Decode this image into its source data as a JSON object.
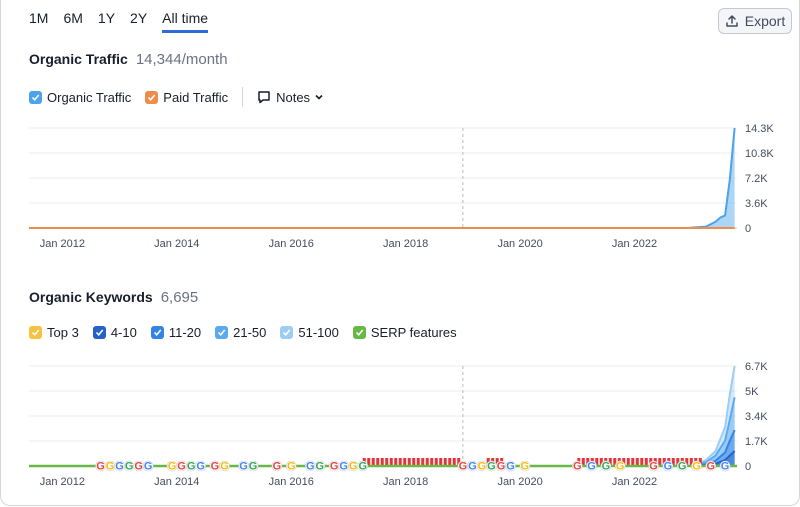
{
  "time_ranges": [
    "1M",
    "6M",
    "1Y",
    "2Y",
    "All time"
  ],
  "active_range": "All time",
  "export": {
    "label": "Export",
    "icon": "upload-icon"
  },
  "traffic": {
    "title": "Organic Traffic",
    "value": "14,344/month",
    "legend": [
      {
        "label": "Organic Traffic",
        "color": "#4aa3ec",
        "checked": true
      },
      {
        "label": "Paid Traffic",
        "color": "#ee8d4a",
        "checked": true
      }
    ],
    "notes_label": "Notes"
  },
  "keywords": {
    "title": "Organic Keywords",
    "value": "6,695",
    "legend": [
      {
        "label": "Top 3",
        "color": "#f5c242",
        "checked": true
      },
      {
        "label": "4-10",
        "color": "#2561c6",
        "checked": true
      },
      {
        "label": "11-20",
        "color": "#3584e4",
        "checked": true
      },
      {
        "label": "21-50",
        "color": "#5aaaf0",
        "checked": true
      },
      {
        "label": "51-100",
        "color": "#9ccdf7",
        "checked": true
      },
      {
        "label": "SERP features",
        "color": "#68b845",
        "checked": true
      }
    ]
  },
  "chart_data": [
    {
      "type": "area",
      "x_ticks": [
        "Jan 2012",
        "Jan 2014",
        "Jan 2016",
        "Jan 2018",
        "Jan 2020",
        "Jan 2022"
      ],
      "y_ticks": [
        "14.3K",
        "10.8K",
        "7.2K",
        "3.6K",
        "0"
      ],
      "ylim": [
        0,
        14344
      ],
      "grid": true,
      "marker": "Jan 2019",
      "series": [
        {
          "name": "Organic Traffic",
          "color": "#4aa3ec",
          "points": [
            [
              "2011-06",
              0
            ],
            [
              "2018-12",
              0
            ],
            [
              "2022-12",
              0
            ],
            [
              "2023-04",
              200
            ],
            [
              "2023-06",
              900
            ],
            [
              "2023-07",
              1500
            ],
            [
              "2023-08",
              1800
            ],
            [
              "2023-09",
              7000
            ],
            [
              "2023-10",
              14344
            ]
          ]
        },
        {
          "name": "Paid Traffic",
          "color": "#ee8d4a",
          "points": [
            [
              "2011-06",
              0
            ],
            [
              "2023-10",
              0
            ]
          ]
        }
      ]
    },
    {
      "type": "area",
      "x_ticks": [
        "Jan 2012",
        "Jan 2014",
        "Jan 2016",
        "Jan 2018",
        "Jan 2020",
        "Jan 2022"
      ],
      "y_ticks": [
        "6.7K",
        "5K",
        "3.4K",
        "1.7K",
        "0"
      ],
      "ylim": [
        0,
        6695
      ],
      "grid": true,
      "marker": "Jan 2019",
      "series": [
        {
          "name": "51-100",
          "color": "#9ccdf7",
          "points": [
            [
              "2011-06",
              0
            ],
            [
              "2023-01",
              0
            ],
            [
              "2023-04",
              400
            ],
            [
              "2023-06",
              1000
            ],
            [
              "2023-08",
              2600
            ],
            [
              "2023-09",
              4800
            ],
            [
              "2023-10",
              6695
            ]
          ]
        },
        {
          "name": "21-50",
          "color": "#5aaaf0",
          "points": [
            [
              "2011-06",
              0
            ],
            [
              "2023-01",
              0
            ],
            [
              "2023-04",
              250
            ],
            [
              "2023-06",
              700
            ],
            [
              "2023-08",
              1700
            ],
            [
              "2023-09",
              3100
            ],
            [
              "2023-10",
              4600
            ]
          ]
        },
        {
          "name": "11-20",
          "color": "#3584e4",
          "points": [
            [
              "2011-06",
              0
            ],
            [
              "2023-01",
              0
            ],
            [
              "2023-04",
              120
            ],
            [
              "2023-06",
              350
            ],
            [
              "2023-08",
              900
            ],
            [
              "2023-09",
              1700
            ],
            [
              "2023-10",
              2400
            ]
          ]
        },
        {
          "name": "4-10",
          "color": "#2561c6",
          "points": [
            [
              "2011-06",
              0
            ],
            [
              "2023-01",
              0
            ],
            [
              "2023-04",
              50
            ],
            [
              "2023-06",
              150
            ],
            [
              "2023-08",
              400
            ],
            [
              "2023-09",
              700
            ],
            [
              "2023-10",
              1000
            ]
          ]
        },
        {
          "name": "Top 3",
          "color": "#f5c242",
          "points": [
            [
              "2011-06",
              0
            ],
            [
              "2023-10",
              0
            ]
          ]
        }
      ],
      "serp_line": {
        "name": "SERP features",
        "color": "#68b845"
      },
      "serp_markers": [
        {
          "date": "2012-09",
          "glyph": "G",
          "color": "#e8453c"
        },
        {
          "date": "2012-11",
          "glyph": "G",
          "color": "#fbbc05"
        },
        {
          "date": "2013-01",
          "glyph": "G",
          "color": "#4285f4"
        },
        {
          "date": "2013-03",
          "glyph": "G",
          "color": "#34a853"
        },
        {
          "date": "2013-05",
          "glyph": "G",
          "color": "#e8453c"
        },
        {
          "date": "2013-07",
          "glyph": "G",
          "color": "#4285f4"
        },
        {
          "date": "2013-12",
          "glyph": "G",
          "color": "#fbbc05"
        },
        {
          "date": "2014-02",
          "glyph": "G",
          "color": "#e8453c"
        },
        {
          "date": "2014-04",
          "glyph": "G",
          "color": "#34a853"
        },
        {
          "date": "2014-06",
          "glyph": "G",
          "color": "#4285f4"
        },
        {
          "date": "2014-09",
          "glyph": "G",
          "color": "#e8453c"
        },
        {
          "date": "2014-11",
          "glyph": "G",
          "color": "#fbbc05"
        },
        {
          "date": "2015-03",
          "glyph": "G",
          "color": "#4285f4"
        },
        {
          "date": "2015-05",
          "glyph": "G",
          "color": "#34a853"
        },
        {
          "date": "2015-10",
          "glyph": "G",
          "color": "#e8453c"
        },
        {
          "date": "2016-01",
          "glyph": "G",
          "color": "#fbbc05"
        },
        {
          "date": "2016-05",
          "glyph": "G",
          "color": "#4285f4"
        },
        {
          "date": "2016-07",
          "glyph": "G",
          "color": "#34a853"
        },
        {
          "date": "2016-10",
          "glyph": "G",
          "color": "#e8453c"
        },
        {
          "date": "2016-12",
          "glyph": "G",
          "color": "#4285f4"
        },
        {
          "date": "2017-02",
          "glyph": "G",
          "color": "#fbbc05"
        },
        {
          "date": "2017-04",
          "glyph": "G",
          "color": "#34a853"
        },
        {
          "date": "2019-01",
          "glyph": "G",
          "color": "#e8453c"
        },
        {
          "date": "2019-03",
          "glyph": "G",
          "color": "#4285f4"
        },
        {
          "date": "2019-05",
          "glyph": "G",
          "color": "#fbbc05"
        },
        {
          "date": "2019-07",
          "glyph": "G",
          "color": "#34a853"
        },
        {
          "date": "2019-09",
          "glyph": "G",
          "color": "#e8453c"
        },
        {
          "date": "2019-11",
          "glyph": "G",
          "color": "#4285f4"
        },
        {
          "date": "2020-02",
          "glyph": "G",
          "color": "#fbbc05"
        },
        {
          "date": "2021-01",
          "glyph": "G",
          "color": "#e8453c"
        },
        {
          "date": "2021-04",
          "glyph": "G",
          "color": "#4285f4"
        },
        {
          "date": "2021-07",
          "glyph": "G",
          "color": "#34a853"
        },
        {
          "date": "2021-10",
          "glyph": "G",
          "color": "#fbbc05"
        },
        {
          "date": "2022-05",
          "glyph": "G",
          "color": "#e8453c"
        },
        {
          "date": "2022-08",
          "glyph": "G",
          "color": "#4285f4"
        },
        {
          "date": "2022-11",
          "glyph": "G",
          "color": "#34a853"
        },
        {
          "date": "2023-02",
          "glyph": "G",
          "color": "#fbbc05"
        },
        {
          "date": "2023-05",
          "glyph": "G",
          "color": "#e8453c"
        },
        {
          "date": "2023-08",
          "glyph": "G",
          "color": "#4285f4"
        }
      ],
      "serp_bars": [
        {
          "from": "2017-04",
          "to": "2018-12",
          "color": "#e5343a"
        },
        {
          "from": "2019-06",
          "to": "2019-09",
          "color": "#e5343a"
        },
        {
          "from": "2021-01",
          "to": "2023-03",
          "color": "#e5343a"
        }
      ]
    }
  ]
}
